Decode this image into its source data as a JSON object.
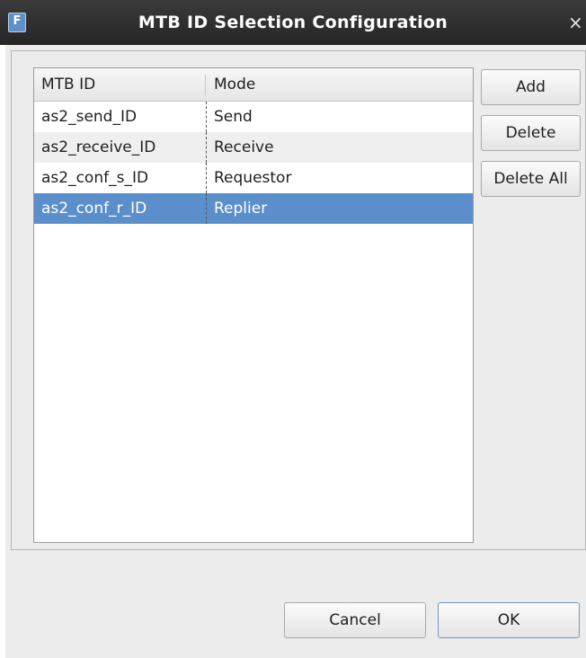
{
  "window": {
    "title": "MTB ID Selection Configuration",
    "close_symbol": "×",
    "app_icon_letter": "F"
  },
  "table": {
    "columns": [
      "MTB ID",
      "Mode"
    ],
    "rows": [
      {
        "id": "as2_send_ID",
        "mode": "Send"
      },
      {
        "id": "as2_receive_ID",
        "mode": "Receive"
      },
      {
        "id": "as2_conf_s_ID",
        "mode": "Requestor"
      },
      {
        "id": "as2_conf_r_ID",
        "mode": "Replier"
      }
    ],
    "selected_index": 3
  },
  "side_buttons": {
    "add": "Add",
    "delete": "Delete",
    "delete_all": "Delete All"
  },
  "footer": {
    "cancel": "Cancel",
    "ok": "OK"
  },
  "colors": {
    "selection": "#5b8fcb",
    "alt_row": "#efefef",
    "titlebar": "#2e2e2e"
  }
}
